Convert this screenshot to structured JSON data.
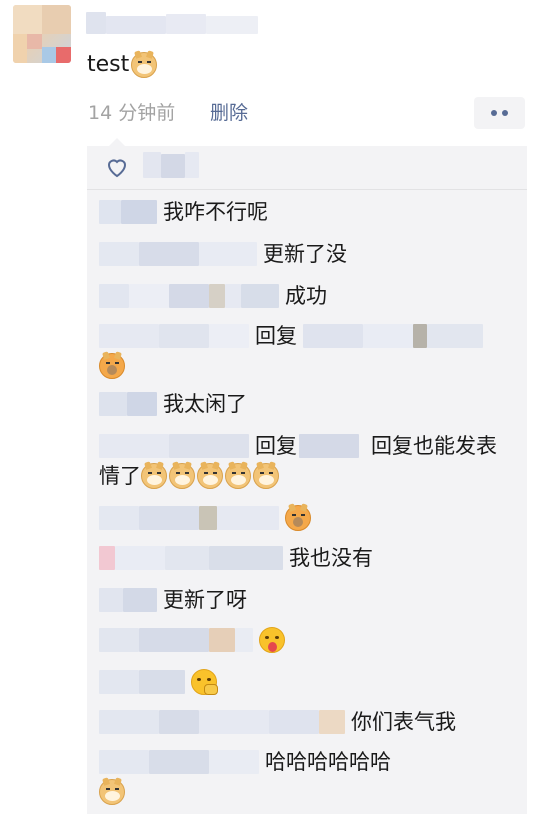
{
  "post": {
    "text": "test",
    "time": "14 分钟前",
    "delete_label": "删除",
    "more_icon": "more-dots-icon"
  },
  "likes": {
    "icon": "heart-outline-icon"
  },
  "comments": [
    {
      "text": "我咋不行呢",
      "emoji": []
    },
    {
      "text": "更新了没",
      "emoji": []
    },
    {
      "text": "成功",
      "emoji": []
    },
    {
      "text": "回复",
      "emoji": [
        "doge-silent"
      ]
    },
    {
      "text": "我太闲了",
      "emoji": []
    },
    {
      "text": "回复",
      "text2": "回复也能发表",
      "text3": "情了",
      "emoji": [
        "doge",
        "doge",
        "doge",
        "doge",
        "doge"
      ]
    },
    {
      "text": "",
      "emoji": [
        "doge-silent"
      ]
    },
    {
      "text": "我也没有",
      "emoji": []
    },
    {
      "text": "更新了呀",
      "emoji": []
    },
    {
      "text": "",
      "emoji": [
        "tongue"
      ]
    },
    {
      "text": "",
      "emoji": [
        "smirk"
      ]
    },
    {
      "text": "你们表气我",
      "emoji": []
    },
    {
      "text": "哈哈哈哈哈哈",
      "emoji": [
        "doge"
      ]
    }
  ],
  "colors": {
    "link": "#576b95",
    "timestamp": "#a3a3a3",
    "panel": "#f3f3f5"
  }
}
